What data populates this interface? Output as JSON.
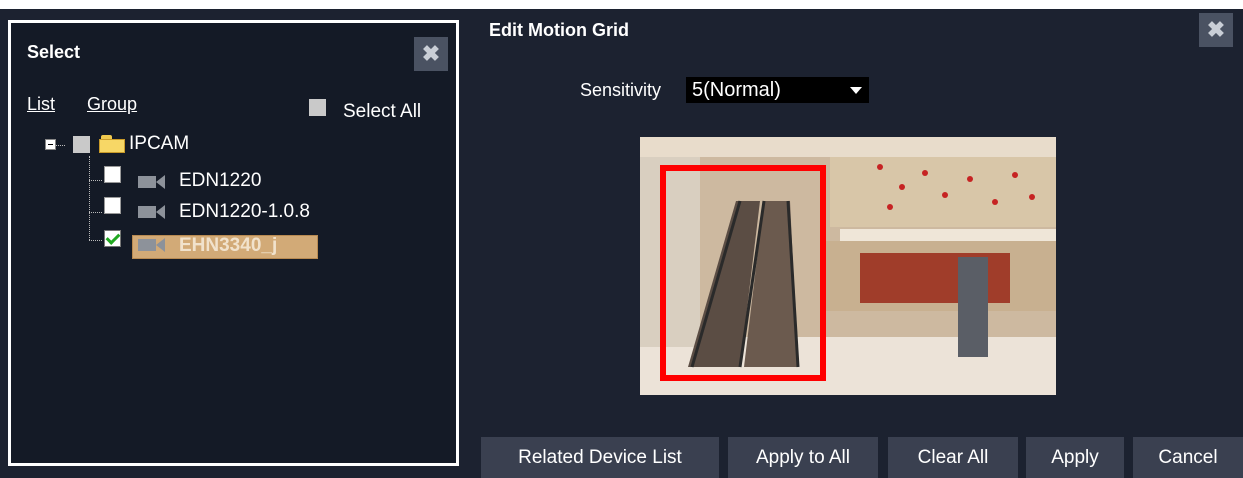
{
  "select_panel": {
    "title": "Select",
    "tabs": [
      "List",
      "Group"
    ],
    "select_all_label": "Select All",
    "tree": {
      "root": {
        "label": "IPCAM",
        "checked": false
      },
      "devices": [
        {
          "label": "EDN1220",
          "checked": false
        },
        {
          "label": "EDN1220-1.0.8",
          "checked": false
        },
        {
          "label": "EHN3340_j",
          "checked": true,
          "selected": true
        }
      ]
    }
  },
  "edit_panel": {
    "title": "Edit Motion Grid",
    "sensitivity_label": "Sensitivity",
    "sensitivity_value": "5(Normal)"
  },
  "buttons": {
    "related": "Related Device List",
    "apply_all": "Apply to All",
    "clear_all": "Clear All",
    "apply": "Apply",
    "cancel": "Cancel"
  },
  "colors": {
    "background": "#1c2230",
    "panel": "#141a26",
    "button": "#3a4050",
    "selection": "#d2aa77",
    "motion_box": "#ff0000",
    "check": "#21a821"
  },
  "icons": [
    "close-icon",
    "folder-icon",
    "camera-icon",
    "chevron-down-icon"
  ]
}
